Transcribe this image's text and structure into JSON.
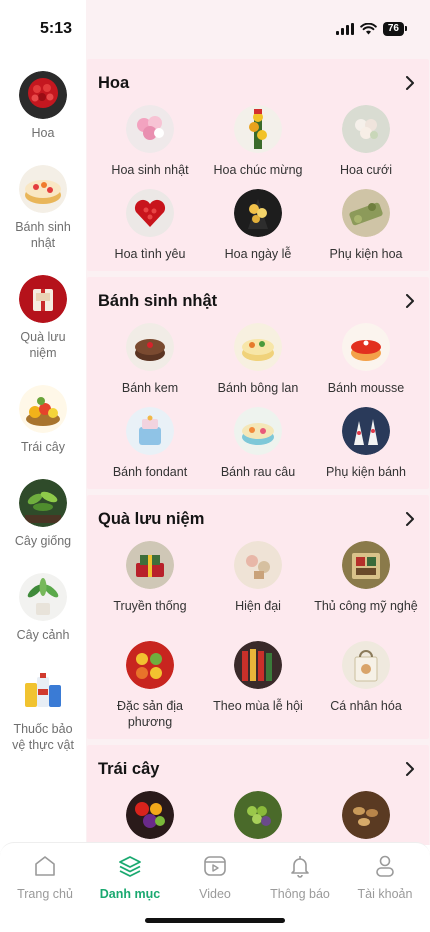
{
  "status_bar": {
    "time": "5:13",
    "battery": "76"
  },
  "sidebar": {
    "items": [
      {
        "label": "Hoa",
        "icon": "flower-bouquet-thumbnail"
      },
      {
        "label": "Bánh sinh nhật",
        "icon": "birthday-cake-thumbnail"
      },
      {
        "label": "Quà lưu niệm",
        "icon": "souvenir-gift-thumbnail"
      },
      {
        "label": "Trái cây",
        "icon": "fruit-basket-thumbnail"
      },
      {
        "label": "Cây giống",
        "icon": "seedling-thumbnail"
      },
      {
        "label": "Cây cảnh",
        "icon": "ornamental-plant-thumbnail"
      },
      {
        "label": "Thuốc bảo vệ thực vật",
        "icon": "pesticide-thumbnail"
      }
    ]
  },
  "sections": [
    {
      "title": "Hoa",
      "items": [
        {
          "label": "Hoa sinh nhật"
        },
        {
          "label": "Hoa chúc mừng"
        },
        {
          "label": "Hoa cưới"
        },
        {
          "label": "Hoa tình yêu"
        },
        {
          "label": "Hoa ngày lễ"
        },
        {
          "label": "Phụ kiện hoa"
        }
      ]
    },
    {
      "title": "Bánh sinh nhật",
      "items": [
        {
          "label": "Bánh kem"
        },
        {
          "label": "Bánh bông lan"
        },
        {
          "label": "Bánh mousse"
        },
        {
          "label": "Bánh fondant"
        },
        {
          "label": "Bánh rau câu"
        },
        {
          "label": "Phụ kiện bánh"
        }
      ]
    },
    {
      "title": "Quà lưu niệm",
      "items": [
        {
          "label": "Truyền thống"
        },
        {
          "label": "Hiện đại"
        },
        {
          "label": "Thủ công mỹ nghệ"
        },
        {
          "label": "Đặc sản địa phương"
        },
        {
          "label": "Theo mùa lễ hội"
        },
        {
          "label": "Cá nhân hóa"
        }
      ]
    },
    {
      "title": "Trái cây",
      "items": [
        {
          "label": ""
        },
        {
          "label": ""
        },
        {
          "label": ""
        }
      ]
    }
  ],
  "bottom_nav": {
    "items": [
      {
        "label": "Trang chủ",
        "icon": "home-icon"
      },
      {
        "label": "Danh mục",
        "icon": "layers-icon"
      },
      {
        "label": "Video",
        "icon": "video-icon"
      },
      {
        "label": "Thông báo",
        "icon": "bell-icon"
      },
      {
        "label": "Tài khoản",
        "icon": "user-icon"
      }
    ],
    "active": "Danh mục"
  },
  "colors": {
    "accent": "#1aa970",
    "content_bg": "#fbf1f3",
    "section_bg": "#fde9ee",
    "inactive_text": "#9a9a9a"
  }
}
